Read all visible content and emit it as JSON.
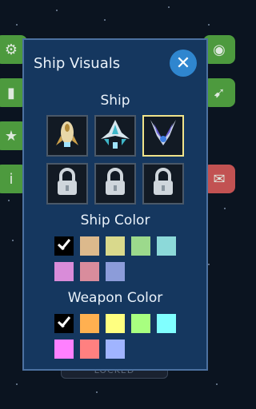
{
  "background": {
    "color": "#0b1420",
    "left_buttons": [
      {
        "name": "settings",
        "icon": "gear-icon",
        "glyph": "⚙"
      },
      {
        "name": "stats",
        "icon": "bar-chart-icon",
        "glyph": "▮"
      },
      {
        "name": "favorites",
        "icon": "star-icon",
        "glyph": "★"
      },
      {
        "name": "info",
        "icon": "info-icon",
        "glyph": "i"
      }
    ],
    "right_buttons": [
      {
        "name": "record",
        "icon": "radio-button-icon",
        "glyph": "◉"
      },
      {
        "name": "ship",
        "icon": "rocket-icon",
        "glyph": "➹"
      },
      {
        "name": "mail",
        "icon": "mail-icon",
        "glyph": "✉"
      }
    ],
    "bottom_button_label": "LOCKED"
  },
  "dialog": {
    "title": "Ship Visuals",
    "close_icon": "close-icon",
    "ship_section_label": "Ship",
    "ships": [
      {
        "id": "ship-1",
        "locked": false,
        "selected": false,
        "icon": "rocket-ship-icon"
      },
      {
        "id": "ship-2",
        "locked": false,
        "selected": false,
        "icon": "fighter-ship-icon"
      },
      {
        "id": "ship-3",
        "locked": false,
        "selected": true,
        "icon": "wing-ship-icon"
      },
      {
        "id": "ship-4",
        "locked": true,
        "selected": false,
        "icon": "lock-icon"
      },
      {
        "id": "ship-5",
        "locked": true,
        "selected": false,
        "icon": "lock-icon"
      },
      {
        "id": "ship-6",
        "locked": true,
        "selected": false,
        "icon": "lock-icon"
      }
    ],
    "ship_color_label": "Ship Color",
    "ship_colors": [
      "#000000",
      "#dcb98c",
      "#d9d98c",
      "#9cd98c",
      "#8cd9d9",
      "#d98cd9",
      "#d98c9c",
      "#8c9cd9"
    ],
    "ship_color_selected_index": 0,
    "weapon_color_label": "Weapon Color",
    "weapon_colors": [
      "#000000",
      "#ffb050",
      "#ffff80",
      "#a8ff80",
      "#80ffff",
      "#ff80ff",
      "#ff8080",
      "#a0b4ff"
    ],
    "weapon_color_selected_index": 0
  }
}
